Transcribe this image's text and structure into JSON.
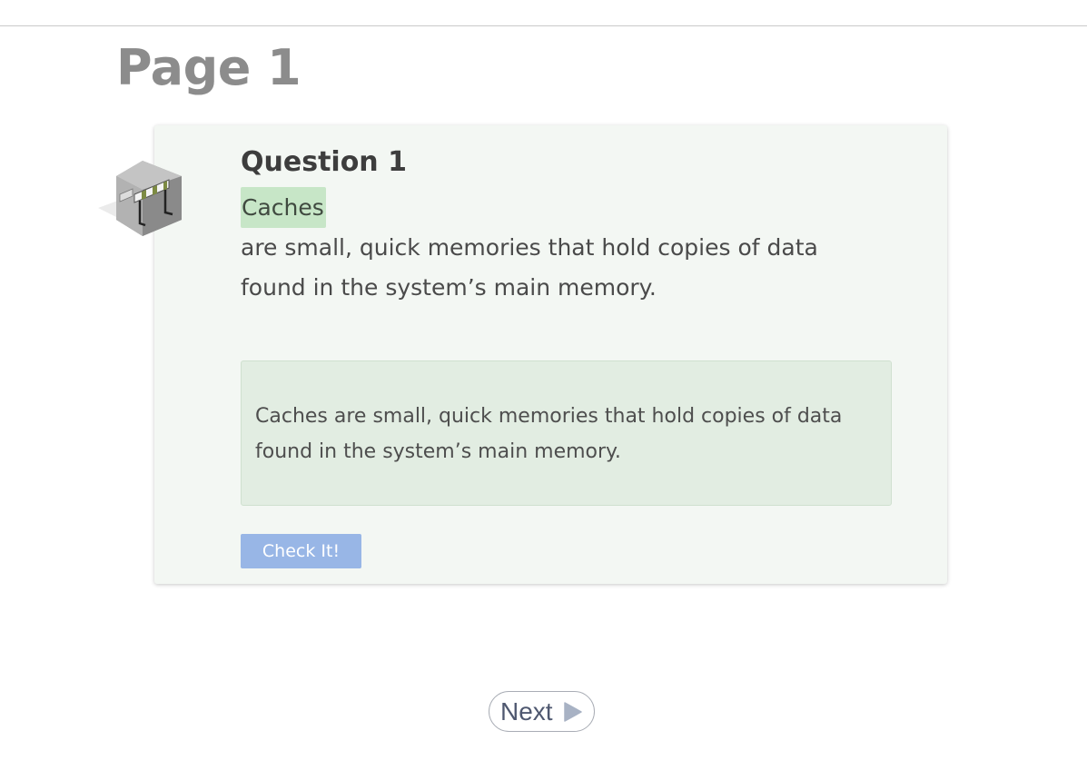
{
  "page": {
    "title": "Page 1"
  },
  "question": {
    "title": "Question 1",
    "term": "Caches",
    "statement": " are small, quick memories that hold copies of data found in the system’s main memory.",
    "feedback": "Caches are small, quick memories that hold copies of data found in the system’s main memory."
  },
  "actions": {
    "check_label": "Check It!",
    "next_label": "Next"
  },
  "icons": {
    "badge": "roadblock-badge-icon",
    "next_arrow": "play-triangle-icon"
  },
  "colors": {
    "page_title": "#8c8c8c",
    "card_background": "#f3f7f3",
    "term_highlight": "#c7e6c7",
    "feedback_background": "#e2ede2",
    "check_button": "#98b6e6",
    "next_text": "#4f5870"
  }
}
